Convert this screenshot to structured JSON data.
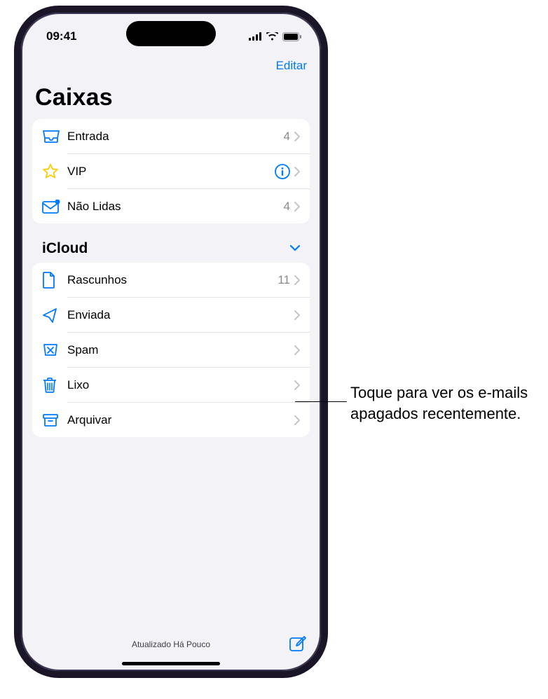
{
  "status": {
    "time": "09:41"
  },
  "nav": {
    "edit_label": "Editar"
  },
  "title": "Caixas",
  "mailboxes": {
    "items": [
      {
        "label": "Entrada",
        "badge": "4",
        "icon": "inbox"
      },
      {
        "label": "VIP",
        "info": true,
        "icon": "star"
      },
      {
        "label": "Não Lidas",
        "badge": "4",
        "icon": "unread"
      }
    ]
  },
  "section": {
    "title": "iCloud",
    "items": [
      {
        "label": "Rascunhos",
        "badge": "11",
        "icon": "doc"
      },
      {
        "label": "Enviada",
        "icon": "send"
      },
      {
        "label": "Spam",
        "icon": "spam"
      },
      {
        "label": "Lixo",
        "icon": "trash"
      },
      {
        "label": "Arquivar",
        "icon": "archive"
      }
    ]
  },
  "footer": {
    "updated": "Atualizado Há Pouco"
  },
  "callout": {
    "text": "Toque para ver os e-mails apagados recentemente."
  }
}
